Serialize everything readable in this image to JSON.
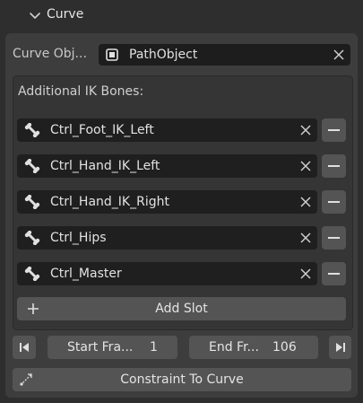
{
  "panel": {
    "title": "Curve"
  },
  "curve_object": {
    "label": "Curve Obj...",
    "value": "PathObject",
    "icon": "curve-object-icon"
  },
  "ik_bones": {
    "title": "Additional IK Bones:",
    "icon": "bone-icon",
    "items": [
      {
        "label": "Ctrl_Foot_IK_Left"
      },
      {
        "label": "Ctrl_Hand_IK_Left"
      },
      {
        "label": "Ctrl_Hand_IK_Right"
      },
      {
        "label": "Ctrl_Hips"
      },
      {
        "label": "Ctrl_Master"
      }
    ],
    "add_slot_label": "Add Slot"
  },
  "frames": {
    "start_label": "Start Fra...",
    "start_value": "1",
    "end_label": "End Fr...",
    "end_value": "106"
  },
  "constraint": {
    "label": "Constraint To Curve",
    "icon": "constraint-icon"
  }
}
